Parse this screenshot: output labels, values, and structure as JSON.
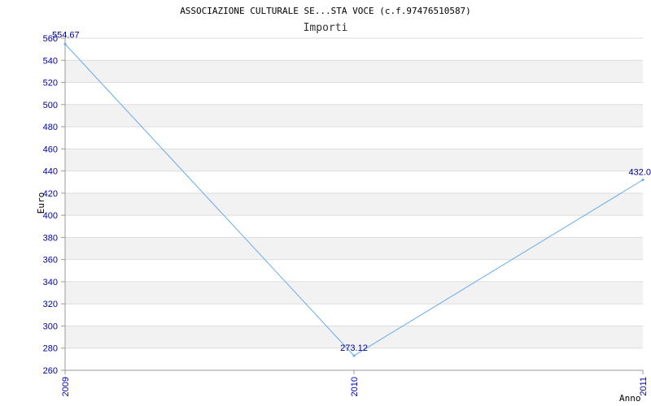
{
  "chart_data": {
    "type": "line",
    "title": "ASSOCIAZIONE CULTURALE SE...STA VOCE (c.f.97476510587)",
    "subtitle": "Importi",
    "xlabel": "Anno",
    "ylabel": "Euro",
    "categories": [
      "2009",
      "2010",
      "2011"
    ],
    "series": [
      {
        "values": [
          554.67,
          273.12,
          432.0
        ],
        "labels": [
          "554.67",
          "273.12",
          "432.0"
        ]
      }
    ],
    "ylim": [
      260,
      560
    ],
    "yticks": [
      260,
      280,
      300,
      320,
      340,
      360,
      380,
      400,
      420,
      440,
      460,
      480,
      500,
      520,
      540,
      560
    ],
    "grid": true,
    "colors": {
      "line": "#66aaee",
      "band": "#f2f2f2",
      "gridline": "#dddddd",
      "tick_text": "#0000aa",
      "data_label": "#000088"
    }
  }
}
